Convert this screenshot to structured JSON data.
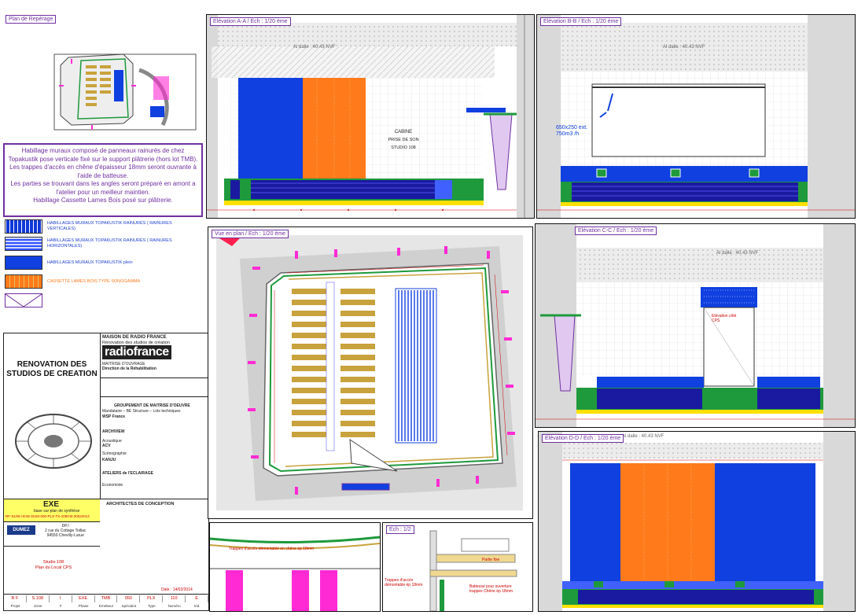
{
  "views": {
    "plan_reperage": {
      "label": "Plan de Repérage"
    },
    "elev_aa": {
      "label": "Elévation A-A / Ech : 1/20 ème",
      "level": "Al dalle : 40.43 NVF",
      "room_label": "CABINE\nPRISE DE SON\nSTUDIO 108"
    },
    "elev_bb": {
      "label": "Elévation B-B / Ech : 1/20 ème",
      "level": "Al dalle : 40.43 NVF",
      "duct": "650x250 ext.\n750m3 /h"
    },
    "vue_plan": {
      "label": "Vue en plan / Ech : 1/20 ème"
    },
    "elev_cc": {
      "label": "Elévation C-C / Ech : 1/20 ème",
      "level": "Al dalle : 40.43 NVF",
      "door_label": "Elévation côté\nCPS"
    },
    "elev_dd": {
      "label": "Elévation D-D / Ech : 1/20 ème",
      "level": "Al dalle : 40.43 NVF"
    },
    "detail_left": {
      "label": "Trappes d'accès démontable en chêne ép 18mm"
    },
    "detail_right": {
      "label": "Ech : 1/2",
      "note1": "Trappes d'accès démontable ép 18mm",
      "note2": "Batteuse pour ouverture trappes Chêne ép 18mm",
      "note3": "Partie fixe"
    }
  },
  "description": "Habillage muraux composé de panneaux rainurés de chez Topakustik pose verticale fixé sur le support plâtrerie (hors lot TMB). Les trappes d'accès en chêne d'épaisseur 18mm seront ouvrante à l'aide de batteuse.\nLes parties se trouvant dans les angles seront préparé en amont a l'atelier pour un meilleur maintien.\nHabillage Cassette Lames Bois posé sur plâtrerie.",
  "legend": [
    {
      "label": "HABILLAGES MURAUX TOPAKUSTIK RAINURÉS ( RAINURES VERTICALES)",
      "color": "#1038d8"
    },
    {
      "label": "HABILLAGES MURAUX TOPAKUSTIK RAINURÉS ( RAINURES HORIZONTALES)",
      "color": "#3050ff"
    },
    {
      "label": "HABILLAGES MURAUX TOPAKUSTIK plein",
      "color": "#1040e0"
    },
    {
      "label": "CASSETTE LAMES BOIS TYPE SONOGAMMA",
      "color": "#ff7a1a"
    },
    {
      "label": "",
      "color": "#7030a0"
    }
  ],
  "cartouche": {
    "project_title": "RENOVATION DES\nSTUDIOS DE CREATION",
    "client": "MAISON DE RADIO FRANCE",
    "client_sub": "Rénovation des studios de création",
    "brand": "radiofrance",
    "moa": "MAITRISE D'OUVRAGE",
    "moa_dir": "Direction de la Réhabilitation",
    "groupement": "GROUPEMENT DE MAITRISE D'OEUVRE",
    "groupement_sub": "Mandataire – BE Structure – Lots techniques",
    "wsp": "WSP France",
    "archi": "ARCHIVIEW",
    "acoustique": "Acoustique",
    "acv": "ACV",
    "scenographie": "Scénographie",
    "kanju": "KANJU",
    "eclairage": "ATELIERS de l'ECLAIRAGE",
    "economiste": "Economiste",
    "architects": "ARCHITECTES DE CONCEPTION",
    "phase": "EXE",
    "phase_sub": "base sur plan de synthèse",
    "ref": "RF-S108-I-EXE-DUM-000-PLX-TX-1090-B-20022014",
    "company": "DUMEZ",
    "company_addr": "DP.I\n2 rue du Cottage Toiliac\n94550 Chevilly-Larue",
    "studio": "Studio 108\nPlan du Local CPS",
    "date": "Date : 14/02/2014",
    "code_values": [
      "R F",
      "S.108",
      "I",
      "EXE",
      "TMB",
      "050",
      "PLX",
      "110",
      "E"
    ],
    "code_labels": [
      "Projet",
      "Zone",
      "F",
      "Phase",
      "Emetteur",
      "Spécialot",
      "Type",
      "Numéro",
      "Ind."
    ]
  },
  "colors": {
    "accent": "#7030a0",
    "blue": "#1040e0",
    "orange": "#ff7a1a",
    "green": "#1e9a3c",
    "magenta": "#ff2ad4"
  }
}
